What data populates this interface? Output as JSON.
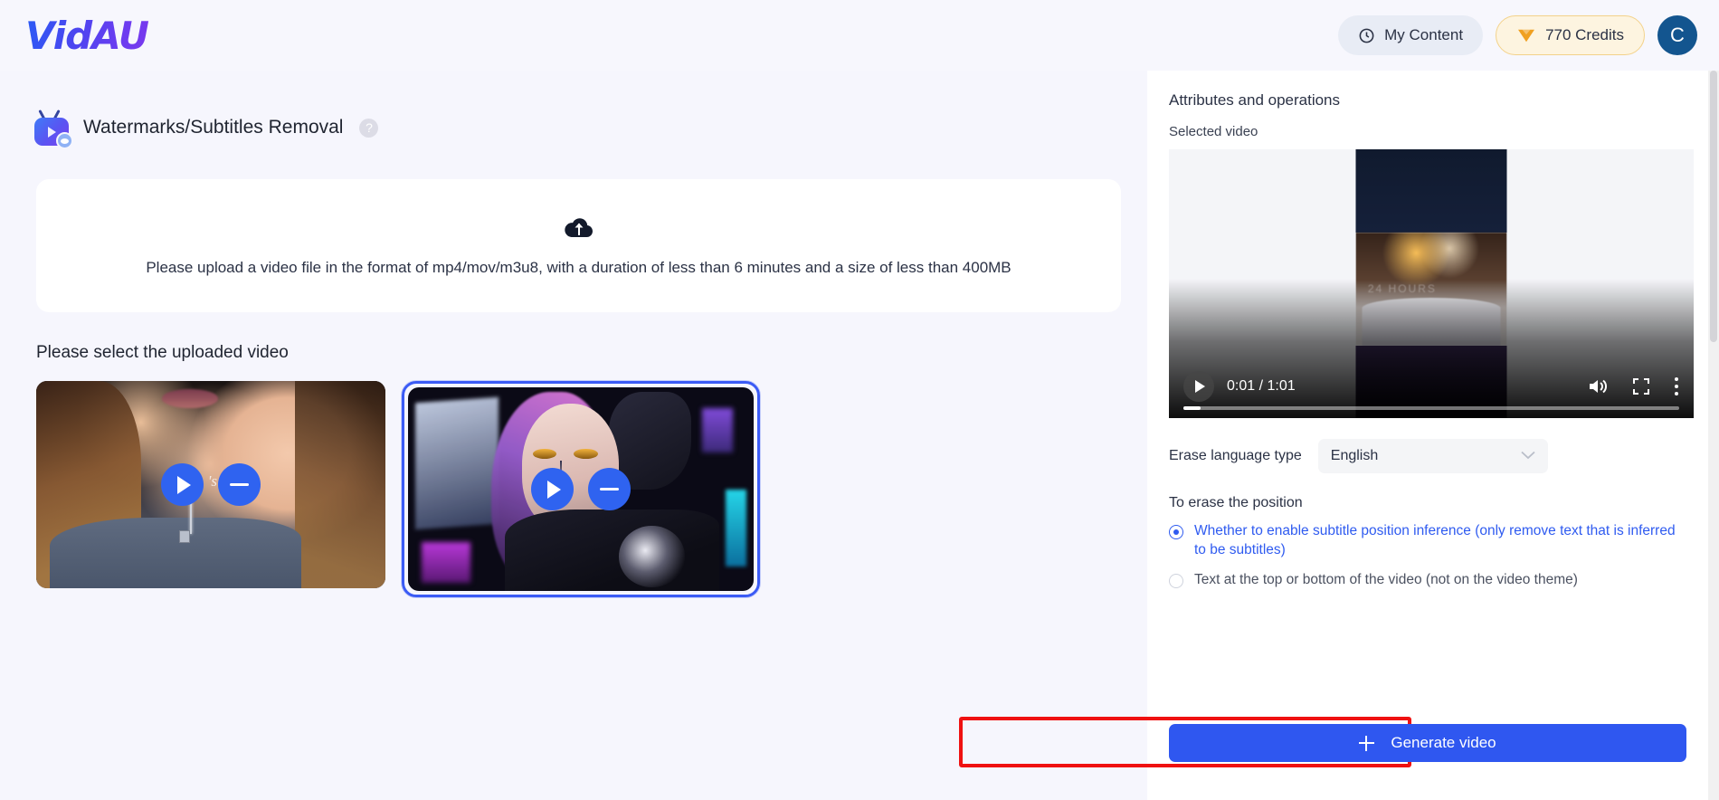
{
  "header": {
    "logo": "VidAU",
    "my_content_label": "My Content",
    "my_content_icon": "clock-icon",
    "credits_label": "770 Credits",
    "credits_icon": "gem-icon",
    "avatar_initial": "C",
    "avatar_color": "#13558f",
    "credits_bg": "#fdf4e0",
    "credits_border": "#f3d28a"
  },
  "tool": {
    "title": "Watermarks/Subtitles Removal",
    "icon": "video-tv-icon",
    "help_icon": "question-mark-icon",
    "help_label": "?"
  },
  "upload": {
    "icon": "cloud-upload-icon",
    "hint": "Please upload a video file in the format of mp4/mov/m3u8, with a duration of less than 6 minutes and a size of less than 400MB"
  },
  "library": {
    "label": "Please select the uploaded video",
    "items": [
      {
        "name": "video-thumbnail-woman",
        "selected": false,
        "play_icon": "play-icon",
        "remove_icon": "minus-icon",
        "watermark_text": "'s Re"
      },
      {
        "name": "video-thumbnail-cyberpunk",
        "selected": true,
        "play_icon": "play-icon",
        "remove_icon": "minus-icon",
        "watermark_text": ""
      }
    ],
    "selected_border_color": "#3b5bf5"
  },
  "panel": {
    "title": "Attributes and operations",
    "selected_video_label": "Selected video",
    "player": {
      "play_icon": "play-icon",
      "current_time": "0:01",
      "duration": "1:01",
      "time_display": "0:01 / 1:01",
      "volume_icon": "volume-icon",
      "fullscreen_icon": "fullscreen-icon",
      "more_icon": "more-vertical-icon",
      "progress_percent": 3.5,
      "watermark_text": "24 HOURS"
    },
    "language": {
      "label": "Erase language type",
      "value": "English",
      "chevron_icon": "chevron-down-icon"
    },
    "position": {
      "label": "To erase the position",
      "options": [
        {
          "text": "Whether to enable subtitle position inference (only remove text that is inferred to be subtitles)",
          "selected": true
        },
        {
          "text": "Text at the top or bottom of the video (not on the video theme)",
          "selected": false
        }
      ],
      "selected_color": "#2f5bf0"
    },
    "generate": {
      "label": "Generate video",
      "plus_icon": "plus-icon",
      "button_color": "#2f57f0",
      "highlight_color": "#ef1111"
    }
  }
}
